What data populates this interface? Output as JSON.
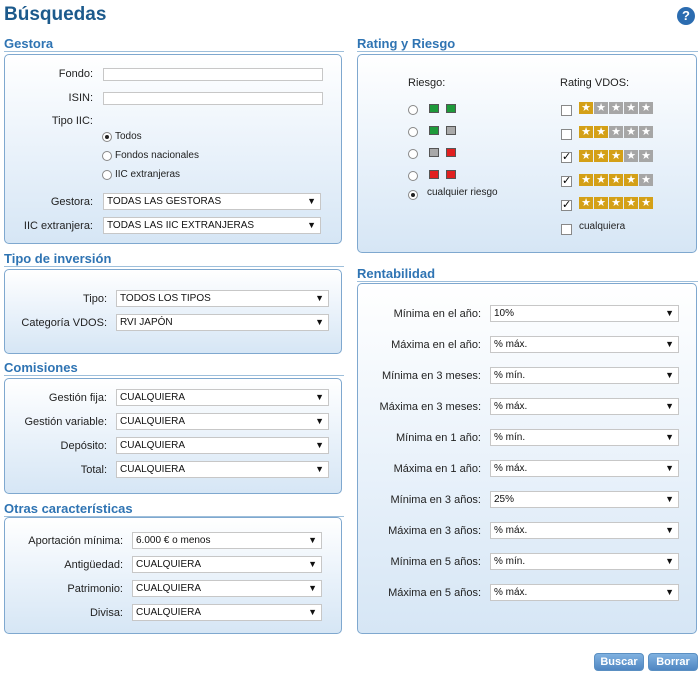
{
  "page_title": "Búsquedas",
  "help_label": "?",
  "gestora": {
    "title": "Gestora",
    "fondo_label": "Fondo:",
    "fondo_value": "",
    "isin_label": "ISIN:",
    "isin_value": "",
    "tipo_label": "Tipo IIC:",
    "tipo_options": [
      "Todos",
      "Fondos nacionales",
      "IIC extranjeras"
    ],
    "gestora_label": "Gestora:",
    "gestora_value": "TODAS LAS GESTORAS",
    "extranjera_label": "IIC extranjera:",
    "extranjera_value": "TODAS LAS IIC EXTRANJERAS"
  },
  "tipo_inversion": {
    "title": "Tipo de inversión",
    "tipo_label": "Tipo:",
    "tipo_value": "TODOS LOS TIPOS",
    "categoria_label": "Categoría VDOS:",
    "categoria_value": "RVI JAPÓN"
  },
  "comisiones": {
    "title": "Comisiones",
    "rows": [
      {
        "label": "Gestión fija:",
        "value": "CUALQUIERA"
      },
      {
        "label": "Gestión variable:",
        "value": "CUALQUIERA"
      },
      {
        "label": "Depósito:",
        "value": "CUALQUIERA"
      },
      {
        "label": "Total:",
        "value": "CUALQUIERA"
      }
    ]
  },
  "otras": {
    "title": "Otras características",
    "rows": [
      {
        "label": "Aportación mínima:",
        "value": "6.000 € o menos"
      },
      {
        "label": "Antigüedad:",
        "value": "CUALQUIERA"
      },
      {
        "label": "Patrimonio:",
        "value": "CUALQUIERA"
      },
      {
        "label": "Divisa:",
        "value": "CUALQUIERA"
      }
    ]
  },
  "rating": {
    "title": "Rating y Riesgo",
    "riesgo_header": "Riesgo:",
    "rating_header": "Rating VDOS:",
    "riesgo_any_label": "cualquier riesgo",
    "rating_any_label": "cualquiera",
    "riesgo_selected": 4,
    "rating_levels": [
      {
        "stars": 1,
        "checked": false
      },
      {
        "stars": 2,
        "checked": false
      },
      {
        "stars": 3,
        "checked": true
      },
      {
        "stars": 4,
        "checked": true
      },
      {
        "stars": 5,
        "checked": true
      }
    ],
    "rating_any_checked": false,
    "colors": {
      "green": "#1e9a3a",
      "red": "#e02020",
      "grey": "#a9a9a9",
      "star": "#d4a017"
    }
  },
  "rentabilidad": {
    "title": "Rentabilidad",
    "rows": [
      {
        "label": "Mínima en el año:",
        "value": "10%"
      },
      {
        "label": "Máxima en el año:",
        "value": "% máx."
      },
      {
        "label": "Mínima en 3 meses:",
        "value": "% mín."
      },
      {
        "label": "Máxima en 3 meses:",
        "value": "% máx."
      },
      {
        "label": "Mínima en 1 año:",
        "value": "% mín."
      },
      {
        "label": "Máxima en 1 año:",
        "value": "% máx."
      },
      {
        "label": "Mínima en 3 años:",
        "value": "25%"
      },
      {
        "label": "Máxima en 3 años:",
        "value": "% máx."
      },
      {
        "label": "Mínima en 5 años:",
        "value": "% mín."
      },
      {
        "label": "Máxima en 5 años:",
        "value": "% máx."
      }
    ]
  },
  "buttons": {
    "search": "Buscar",
    "clear": "Borrar"
  }
}
